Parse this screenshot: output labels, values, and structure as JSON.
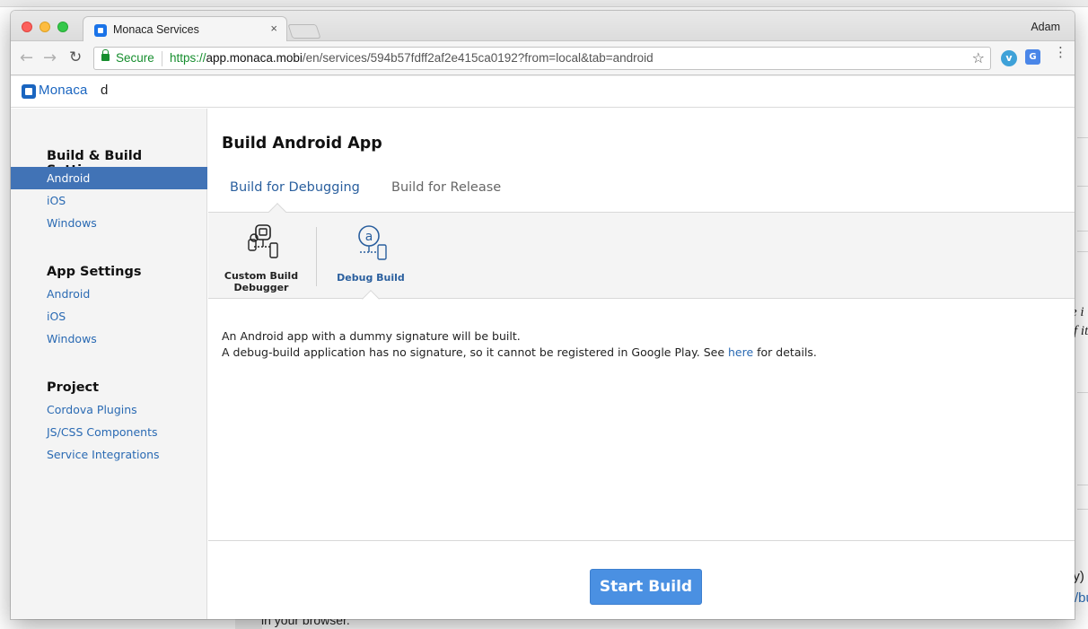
{
  "browser": {
    "tab_title": "Monaca Services",
    "tab_close": "×",
    "profile_name": "Adam",
    "secure_label": "Secure",
    "url_proto": "https://",
    "url_host": "app.monaca.mobi",
    "url_path": "/en/services/594b57fdff2af2e415ca0192?from=local&tab=android",
    "back_icon": "←",
    "forward_icon": "→",
    "reload_icon": "↻",
    "star_icon": "☆",
    "menu_icon": "⋮"
  },
  "app_header": {
    "logo_text": "Monaca",
    "project_name": "d"
  },
  "sidebar": {
    "sections": [
      {
        "heading": "Build & Build Settings",
        "items": [
          "Android",
          "iOS",
          "Windows"
        ]
      },
      {
        "heading": "App Settings",
        "items": [
          "Android",
          "iOS",
          "Windows"
        ]
      },
      {
        "heading": "Project",
        "items": [
          "Cordova Plugins",
          "JS/CSS Components",
          "Service Integrations"
        ]
      }
    ],
    "active_item": "Build & Build Settings / Android"
  },
  "main": {
    "title": "Build Android App",
    "tabs": [
      {
        "label": "Build for Debugging",
        "active": true
      },
      {
        "label": "Build for Release",
        "active": false
      }
    ],
    "options": [
      {
        "label_line1": "Custom Build",
        "label_line2": "Debugger",
        "icon": "custom-build-debugger-icon",
        "selected": false
      },
      {
        "label_line1": "Debug Build",
        "icon": "debug-build-icon",
        "selected": true
      }
    ],
    "description_line1": "An Android app with a dummy signature will be built.",
    "description_line2_before": "A debug-build application has no signature, so it cannot be registered in Google Play. See ",
    "description_link": "here",
    "description_line2_after": " for details.",
    "start_button": "Start Build"
  },
  "background_page": {
    "frag_right_1": "e i",
    "frag_right_2": "f it",
    "frag_right_3": "ly)",
    "frag_right_4": "/bu",
    "frag_bottom": "in your browser."
  },
  "colors": {
    "accent": "#4173b6",
    "link": "#2a6ab3",
    "button": "#4a90e2",
    "secure": "#168e2e"
  }
}
